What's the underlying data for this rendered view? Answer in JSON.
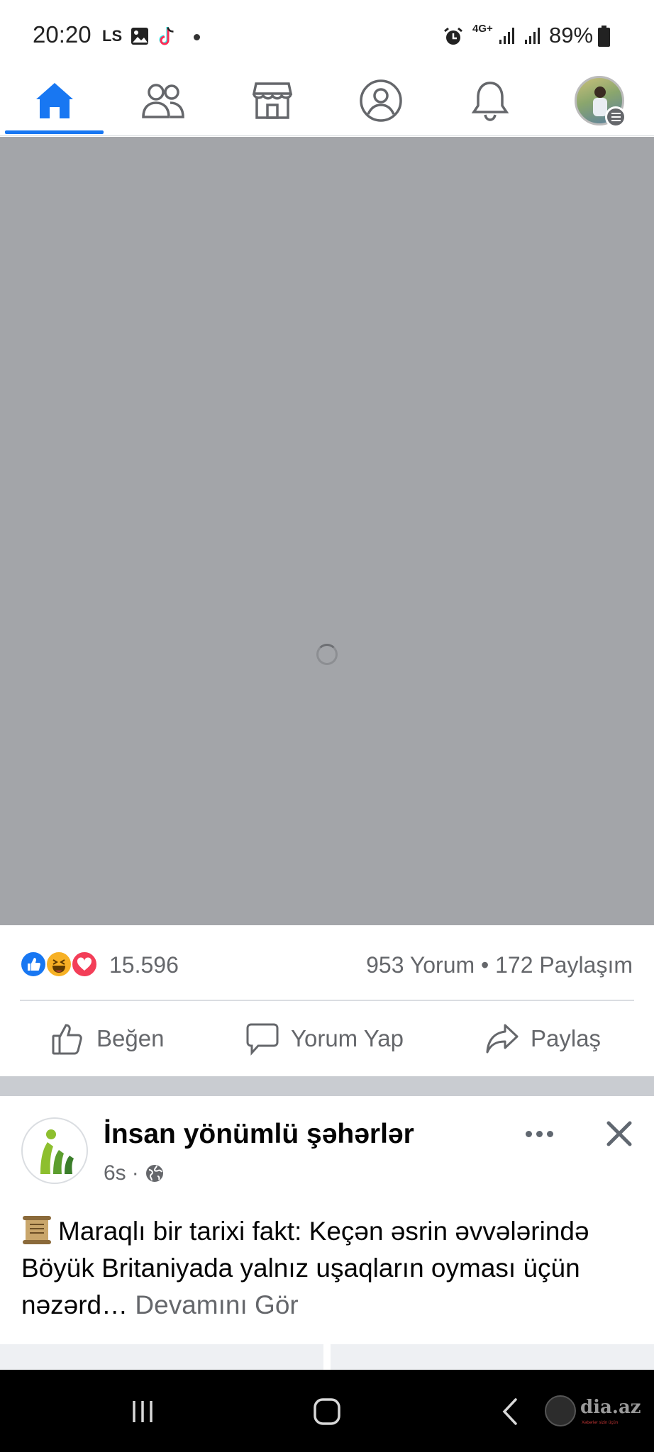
{
  "status_bar": {
    "time": "20:20",
    "carrier_label": "LS",
    "network": "4G+",
    "battery": "89%"
  },
  "top_nav": {
    "tabs": [
      {
        "id": "home",
        "icon": "home-icon",
        "active": true
      },
      {
        "id": "friends",
        "icon": "friends-icon"
      },
      {
        "id": "marketplace",
        "icon": "marketplace-icon"
      },
      {
        "id": "profile",
        "icon": "profile-icon"
      },
      {
        "id": "notifications",
        "icon": "bell-icon"
      },
      {
        "id": "menu",
        "icon": "avatar-menu-icon"
      }
    ],
    "accent": "#1877f2"
  },
  "post": {
    "reactions": [
      "like",
      "haha",
      "love"
    ],
    "reaction_count": "15.596",
    "stats": "953 Yorum • 172 Paylaşım",
    "actions": {
      "like": "Beğen",
      "comment": "Yorum Yap",
      "share": "Paylaş"
    }
  },
  "next_post": {
    "page_name": "İnsan yönümlü şəhərlər",
    "time": "6s",
    "separator": "·",
    "privacy_icon": "globe-icon",
    "text": "Maraqlı bir tarixi fakt: Keçən əsrin əvvələrində Böyük Britaniyada yalnız uşaqların oyması üçün nəzərd…",
    "see_more": "Devamını Gör"
  },
  "watermark": {
    "site": "dia.az",
    "tagline": "Xəbərlər sizin üçün"
  }
}
